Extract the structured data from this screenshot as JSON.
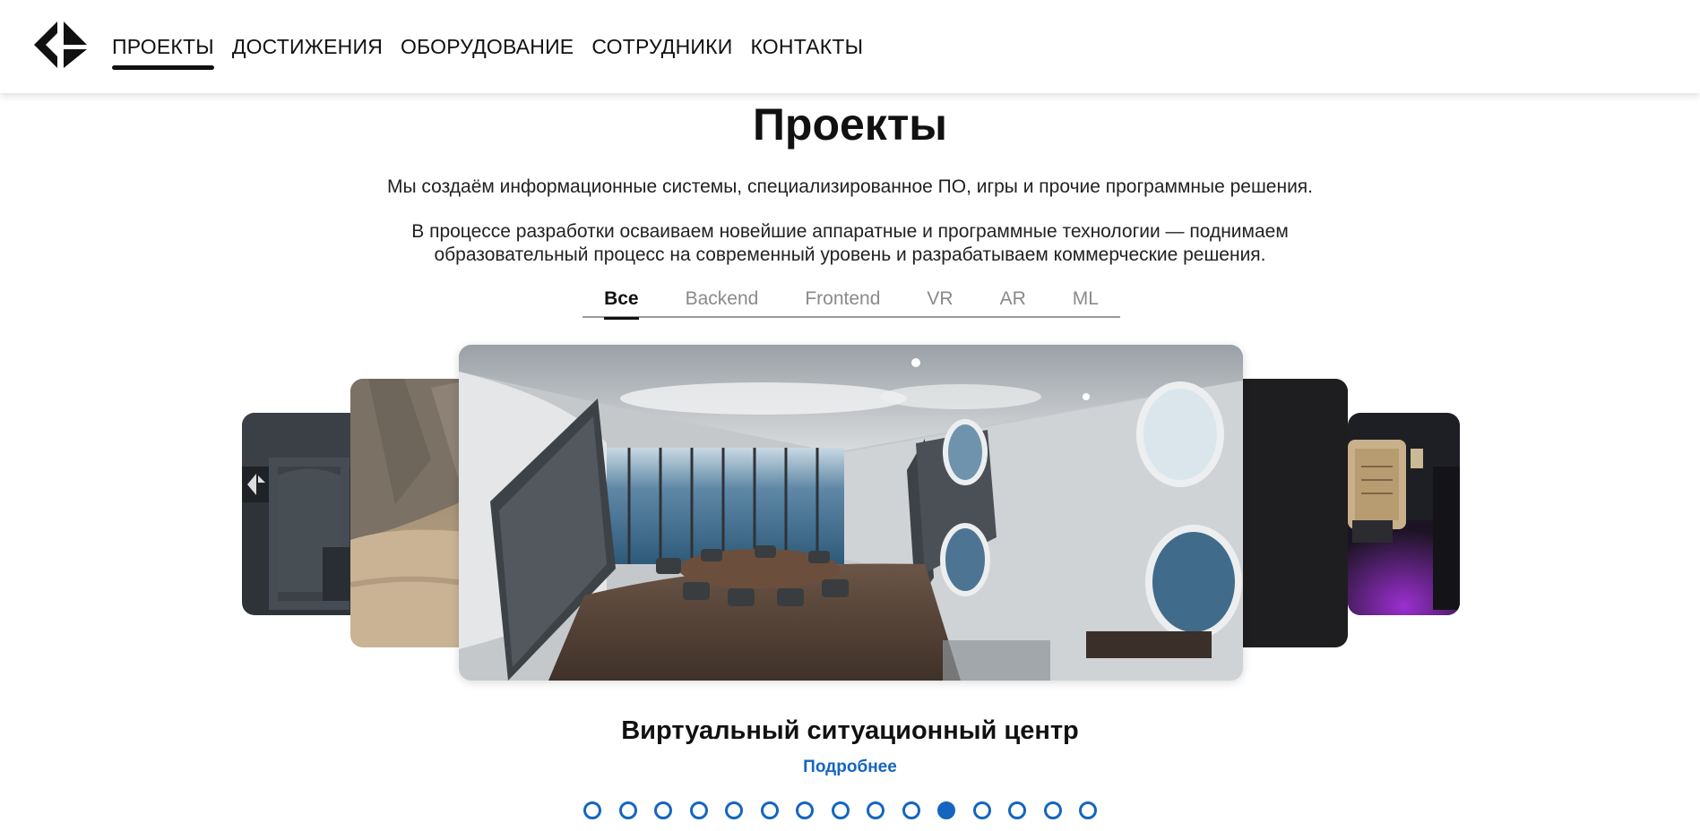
{
  "header": {
    "logo_icon": "diamond-arrows-logo",
    "nav": [
      {
        "label": "ПРОЕКТЫ",
        "active": true
      },
      {
        "label": "ДОСТИЖЕНИЯ",
        "active": false
      },
      {
        "label": "ОБОРУДОВАНИЕ",
        "active": false
      },
      {
        "label": "СОТРУДНИКИ",
        "active": false
      },
      {
        "label": "КОНТАКТЫ",
        "active": false
      }
    ]
  },
  "hero": {
    "title": "Проекты",
    "paragraph_1": "Мы создаём информационные системы, специализированное ПО, игры и прочие программные решения.",
    "paragraph_2_line_1": "В процессе разработки осваиваем новейшие аппаратные и программные технологии — поднимаем",
    "paragraph_2_line_2": "образовательный процесс на современный уровень и разрабатываем коммерческие решения."
  },
  "filters": [
    {
      "label": "Все",
      "active": true
    },
    {
      "label": "Backend",
      "active": false
    },
    {
      "label": "Frontend",
      "active": false
    },
    {
      "label": "VR",
      "active": false
    },
    {
      "label": "AR",
      "active": false
    },
    {
      "label": "ML",
      "active": false
    }
  ],
  "carousel": {
    "current_project_title": "Виртуальный ситуационный центр",
    "more_link_label": "Подробнее",
    "total_slides": 15,
    "active_index": 10
  },
  "colors": {
    "accent": "#1565c0",
    "text": "#111111",
    "muted": "#8a8a8a"
  }
}
